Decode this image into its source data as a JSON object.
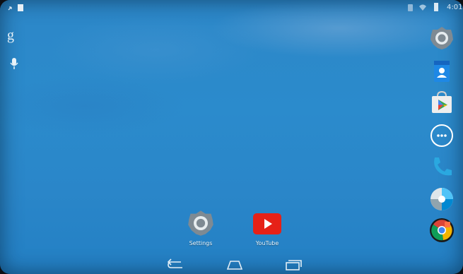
{
  "status_bar": {
    "time": "4:01"
  },
  "left_widgets": {
    "google_search_label": "g",
    "voice_search_icon": "mic-icon"
  },
  "dock": [
    {
      "name": "settings-app",
      "icon": "gear-icon"
    },
    {
      "name": "contacts-app",
      "icon": "contacts-icon"
    },
    {
      "name": "play-store-app",
      "icon": "play-store-icon"
    },
    {
      "name": "app-drawer",
      "icon": "apps-grid-icon"
    },
    {
      "name": "phone-app",
      "icon": "phone-icon"
    },
    {
      "name": "photos-app",
      "icon": "photos-icon"
    },
    {
      "name": "chrome-app",
      "icon": "chrome-icon"
    }
  ],
  "home_apps": [
    {
      "label": "Settings",
      "icon": "gear-icon"
    },
    {
      "label": "YouTube",
      "icon": "youtube-icon"
    }
  ],
  "nav_bar": {
    "back_icon": "back-icon",
    "home_icon": "home-icon",
    "recents_icon": "recents-icon"
  },
  "colors": {
    "wallpaper": "#2b89ca",
    "youtube_red": "#e62117",
    "settings_gray": "#7e8a93"
  }
}
